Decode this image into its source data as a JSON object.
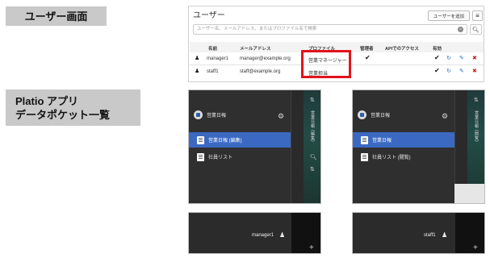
{
  "labels": {
    "users": "ユーザー画面",
    "platio_line1": "Platio アプリ",
    "platio_line2": "データポケット一覧"
  },
  "user_panel": {
    "title": "ユーザー",
    "add_button": "ユーザーを追加",
    "menu_icon": "hamburger-icon",
    "search_placeholder": "ユーザー名、メールアドレス、またはプロファイル名で検索",
    "columns": [
      "名前",
      "メールアドレス",
      "プロファイル",
      "管理者",
      "APIでのアクセス",
      "有効"
    ],
    "rows": [
      {
        "name": "manager1",
        "email": "manager@example.org",
        "profile": "営業マネージャー",
        "admin": "✔",
        "api": "",
        "enabled": "✔"
      },
      {
        "name": "staff1",
        "email": "staff@example.org",
        "profile": "営業担当",
        "admin": "",
        "api": "",
        "enabled": "✔"
      }
    ],
    "highlight_color": "#e3131b"
  },
  "phones": {
    "app_name": "営業日報",
    "left": {
      "items": [
        "営業日報 (編集)",
        "社員リスト"
      ],
      "side_text": "営業日報 (編集)"
    },
    "right": {
      "items": [
        "営業日報",
        "社員リスト (閲覧)"
      ],
      "side_text": "営業日報 (閲覧)"
    },
    "footer_left_user": "manager1",
    "footer_right_user": "staff1"
  },
  "colors": {
    "active_item": "#3b69c2",
    "drawer_bg": "#2f2f2f",
    "label_bg": "#c9c9c9"
  }
}
